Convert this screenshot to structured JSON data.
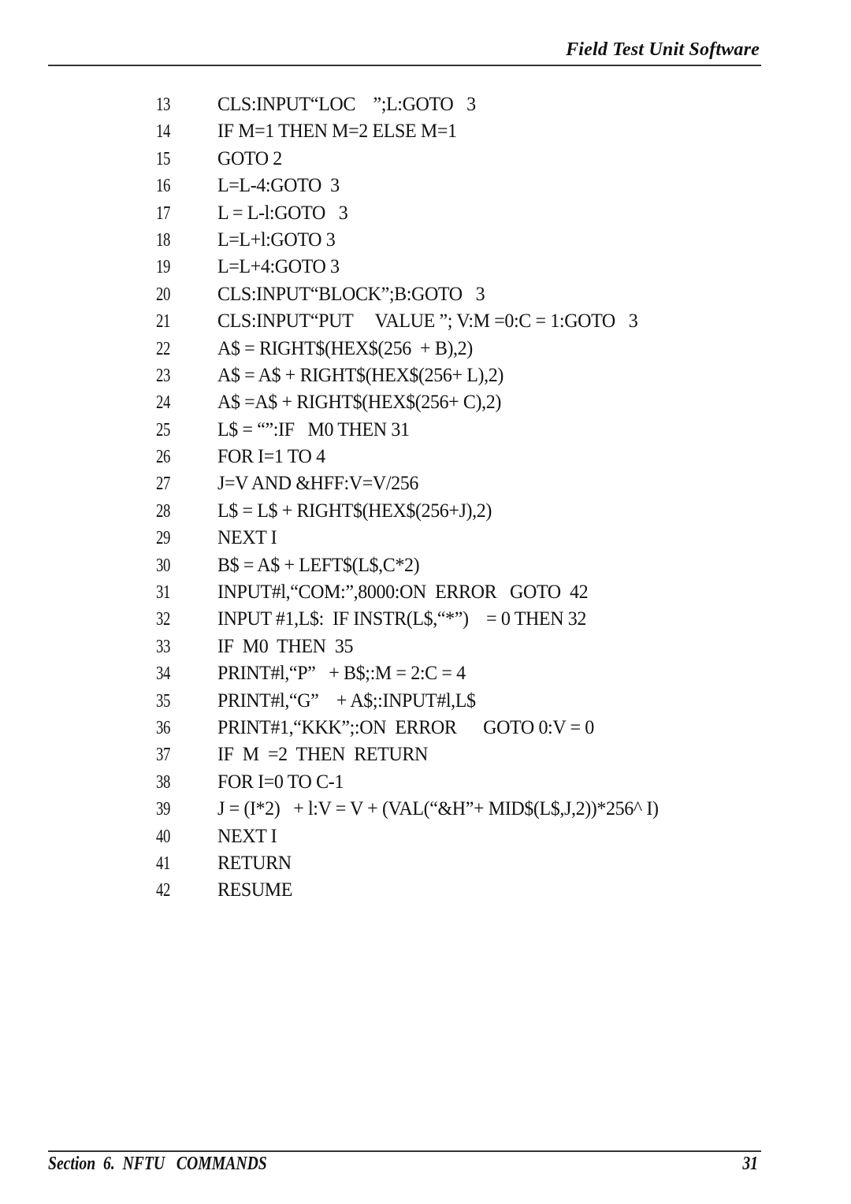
{
  "header": {
    "title": "Field Test Unit Software"
  },
  "listing": {
    "lines": [
      {
        "number": "13",
        "text": "CLS:INPUT“LOC    ”;L:GOTO   3"
      },
      {
        "number": "14",
        "text": "IF M=1 THEN M=2 ELSE M=1"
      },
      {
        "number": "15",
        "text": "GOTO 2"
      },
      {
        "number": "16",
        "text": "L=L-4:GOTO  3"
      },
      {
        "number": "17",
        "text": "L = L-l:GOTO   3"
      },
      {
        "number": "18",
        "text": "L=L+l:GOTO 3"
      },
      {
        "number": "19",
        "text": "L=L+4:GOTO 3"
      },
      {
        "number": "20",
        "text": "CLS:INPUT“BLOCK”;B:GOTO   3"
      },
      {
        "number": "21",
        "text": "CLS:INPUT“PUT     VALUE ”; V:M =0:C = 1:GOTO   3"
      },
      {
        "number": "22",
        "text": "A$ = RIGHT$(HEX$(256  + B),2)"
      },
      {
        "number": "23",
        "text": "A$ = A$ + RIGHT$(HEX$(256+ L),2)"
      },
      {
        "number": "24",
        "text": "A$ =A$ + RIGHT$(HEX$(256+ C),2)"
      },
      {
        "number": "25",
        "text": "L$ = “”:IF   M0 THEN 31"
      },
      {
        "number": "26",
        "text": "FOR I=1 TO 4"
      },
      {
        "number": "27",
        "text": "J=V AND &HFF:V=V/256"
      },
      {
        "number": "28",
        "text": "L$ = L$ + RIGHT$(HEX$(256+J),2)"
      },
      {
        "number": "29",
        "text": "NEXT I"
      },
      {
        "number": "30",
        "text": "B$ = A$ + LEFT$(L$,C*2)"
      },
      {
        "number": "31",
        "text": "INPUT#l,“COM:”,8000:ON  ERROR   GOTO  42"
      },
      {
        "number": "32",
        "text": "INPUT #1,L$:  IF INSTR(L$,“*”)    = 0 THEN 32"
      },
      {
        "number": "33",
        "text": "IF  M0  THEN  35"
      },
      {
        "number": "34",
        "text": "PRINT#l,“P”   + B$;:M = 2:C = 4"
      },
      {
        "number": "35",
        "text": "PRINT#l,“G”    + A$;:INPUT#l,L$"
      },
      {
        "number": "36",
        "text": "PRINT#1,“KKK”;:ON  ERROR      GOTO 0:V = 0"
      },
      {
        "number": "37",
        "text": "IF  M  =2  THEN  RETURN"
      },
      {
        "number": "38",
        "text": "FOR I=0 TO C-1"
      },
      {
        "number": "39",
        "text": "J = (I*2)   + l:V = V + (VAL(“&H”+ MID$(L$,J,2))*256^ I)"
      },
      {
        "number": "40",
        "text": "NEXT I"
      },
      {
        "number": "41",
        "text": "RETURN"
      },
      {
        "number": "42",
        "text": "RESUME"
      }
    ]
  },
  "footer": {
    "section": "Section  6.  NFTU   COMMANDS",
    "page_number": "31"
  }
}
